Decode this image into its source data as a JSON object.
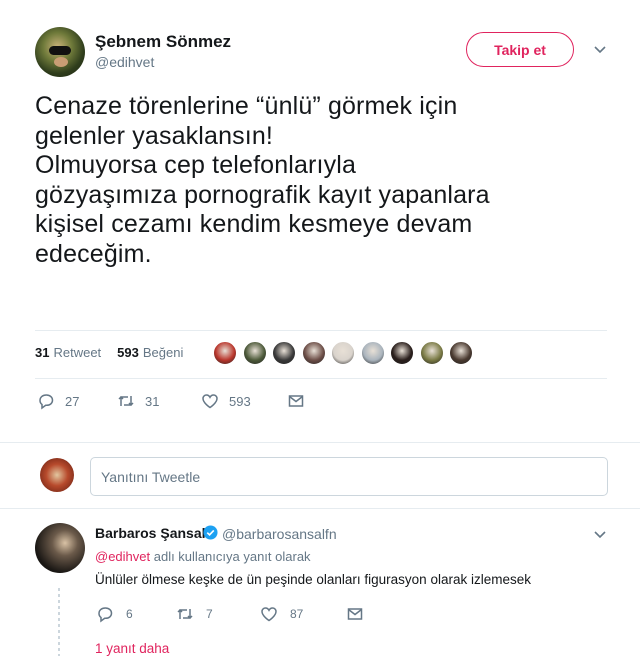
{
  "author": {
    "name": "Şebnem Sönmez",
    "handle": "@edihvet"
  },
  "follow_button": "Takip et",
  "tweet": {
    "lines": [
      "Cenaze törenlerine “ünlü” görmek için",
      "gelenler yasaklansın!",
      "Olmuyorsa cep telefonlarıyla",
      "gözyaşımıza pornografik kayıt yapanlara",
      "kişisel cezamı kendim kesmeye devam",
      "edeceğim."
    ]
  },
  "stats": {
    "retweets": "31",
    "retweets_label": "Retweet",
    "likes": "593",
    "likes_label": "Beğeni"
  },
  "liker_avatars": [
    "#b9362c",
    "#4d5a3a",
    "#3a3a3a",
    "#6d4f48",
    "#d9d3cc",
    "#aab4bd",
    "#2a1f1c",
    "#7a7a45",
    "#4a3a30"
  ],
  "actions": {
    "reply_count": "27",
    "retweet_count": "31",
    "like_count": "593"
  },
  "reply_box": {
    "placeholder": "Yanıtını Tweetle"
  },
  "reply": {
    "name": "Barbaros Şansal",
    "handle": "@barbarosansalfn",
    "context_mention": "@edihvet",
    "context_text": " adlı kullanıcıya yanıt olarak",
    "text": "Ünlüler ölmese keşke de ün peşinde olanları figurasyon olarak izlemesek",
    "reply_count": "6",
    "retweet_count": "7",
    "like_count": "87"
  },
  "more_replies": "1 yanıt daha",
  "colors": {
    "accent": "#e0245e",
    "muted": "#657786",
    "verified": "#1da1f2"
  }
}
